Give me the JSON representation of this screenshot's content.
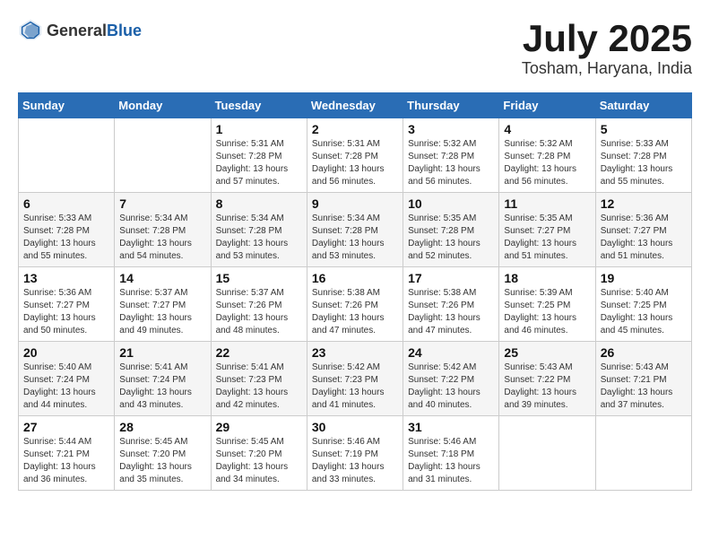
{
  "header": {
    "logo": {
      "general": "General",
      "blue": "Blue"
    },
    "title": "July 2025",
    "location": "Tosham, Haryana, India"
  },
  "weekdays": [
    "Sunday",
    "Monday",
    "Tuesday",
    "Wednesday",
    "Thursday",
    "Friday",
    "Saturday"
  ],
  "weeks": [
    [
      {
        "day": "",
        "info": ""
      },
      {
        "day": "",
        "info": ""
      },
      {
        "day": "1",
        "info": "Sunrise: 5:31 AM\nSunset: 7:28 PM\nDaylight: 13 hours and 57 minutes."
      },
      {
        "day": "2",
        "info": "Sunrise: 5:31 AM\nSunset: 7:28 PM\nDaylight: 13 hours and 56 minutes."
      },
      {
        "day": "3",
        "info": "Sunrise: 5:32 AM\nSunset: 7:28 PM\nDaylight: 13 hours and 56 minutes."
      },
      {
        "day": "4",
        "info": "Sunrise: 5:32 AM\nSunset: 7:28 PM\nDaylight: 13 hours and 56 minutes."
      },
      {
        "day": "5",
        "info": "Sunrise: 5:33 AM\nSunset: 7:28 PM\nDaylight: 13 hours and 55 minutes."
      }
    ],
    [
      {
        "day": "6",
        "info": "Sunrise: 5:33 AM\nSunset: 7:28 PM\nDaylight: 13 hours and 55 minutes."
      },
      {
        "day": "7",
        "info": "Sunrise: 5:34 AM\nSunset: 7:28 PM\nDaylight: 13 hours and 54 minutes."
      },
      {
        "day": "8",
        "info": "Sunrise: 5:34 AM\nSunset: 7:28 PM\nDaylight: 13 hours and 53 minutes."
      },
      {
        "day": "9",
        "info": "Sunrise: 5:34 AM\nSunset: 7:28 PM\nDaylight: 13 hours and 53 minutes."
      },
      {
        "day": "10",
        "info": "Sunrise: 5:35 AM\nSunset: 7:28 PM\nDaylight: 13 hours and 52 minutes."
      },
      {
        "day": "11",
        "info": "Sunrise: 5:35 AM\nSunset: 7:27 PM\nDaylight: 13 hours and 51 minutes."
      },
      {
        "day": "12",
        "info": "Sunrise: 5:36 AM\nSunset: 7:27 PM\nDaylight: 13 hours and 51 minutes."
      }
    ],
    [
      {
        "day": "13",
        "info": "Sunrise: 5:36 AM\nSunset: 7:27 PM\nDaylight: 13 hours and 50 minutes."
      },
      {
        "day": "14",
        "info": "Sunrise: 5:37 AM\nSunset: 7:27 PM\nDaylight: 13 hours and 49 minutes."
      },
      {
        "day": "15",
        "info": "Sunrise: 5:37 AM\nSunset: 7:26 PM\nDaylight: 13 hours and 48 minutes."
      },
      {
        "day": "16",
        "info": "Sunrise: 5:38 AM\nSunset: 7:26 PM\nDaylight: 13 hours and 47 minutes."
      },
      {
        "day": "17",
        "info": "Sunrise: 5:38 AM\nSunset: 7:26 PM\nDaylight: 13 hours and 47 minutes."
      },
      {
        "day": "18",
        "info": "Sunrise: 5:39 AM\nSunset: 7:25 PM\nDaylight: 13 hours and 46 minutes."
      },
      {
        "day": "19",
        "info": "Sunrise: 5:40 AM\nSunset: 7:25 PM\nDaylight: 13 hours and 45 minutes."
      }
    ],
    [
      {
        "day": "20",
        "info": "Sunrise: 5:40 AM\nSunset: 7:24 PM\nDaylight: 13 hours and 44 minutes."
      },
      {
        "day": "21",
        "info": "Sunrise: 5:41 AM\nSunset: 7:24 PM\nDaylight: 13 hours and 43 minutes."
      },
      {
        "day": "22",
        "info": "Sunrise: 5:41 AM\nSunset: 7:23 PM\nDaylight: 13 hours and 42 minutes."
      },
      {
        "day": "23",
        "info": "Sunrise: 5:42 AM\nSunset: 7:23 PM\nDaylight: 13 hours and 41 minutes."
      },
      {
        "day": "24",
        "info": "Sunrise: 5:42 AM\nSunset: 7:22 PM\nDaylight: 13 hours and 40 minutes."
      },
      {
        "day": "25",
        "info": "Sunrise: 5:43 AM\nSunset: 7:22 PM\nDaylight: 13 hours and 39 minutes."
      },
      {
        "day": "26",
        "info": "Sunrise: 5:43 AM\nSunset: 7:21 PM\nDaylight: 13 hours and 37 minutes."
      }
    ],
    [
      {
        "day": "27",
        "info": "Sunrise: 5:44 AM\nSunset: 7:21 PM\nDaylight: 13 hours and 36 minutes."
      },
      {
        "day": "28",
        "info": "Sunrise: 5:45 AM\nSunset: 7:20 PM\nDaylight: 13 hours and 35 minutes."
      },
      {
        "day": "29",
        "info": "Sunrise: 5:45 AM\nSunset: 7:20 PM\nDaylight: 13 hours and 34 minutes."
      },
      {
        "day": "30",
        "info": "Sunrise: 5:46 AM\nSunset: 7:19 PM\nDaylight: 13 hours and 33 minutes."
      },
      {
        "day": "31",
        "info": "Sunrise: 5:46 AM\nSunset: 7:18 PM\nDaylight: 13 hours and 31 minutes."
      },
      {
        "day": "",
        "info": ""
      },
      {
        "day": "",
        "info": ""
      }
    ]
  ]
}
